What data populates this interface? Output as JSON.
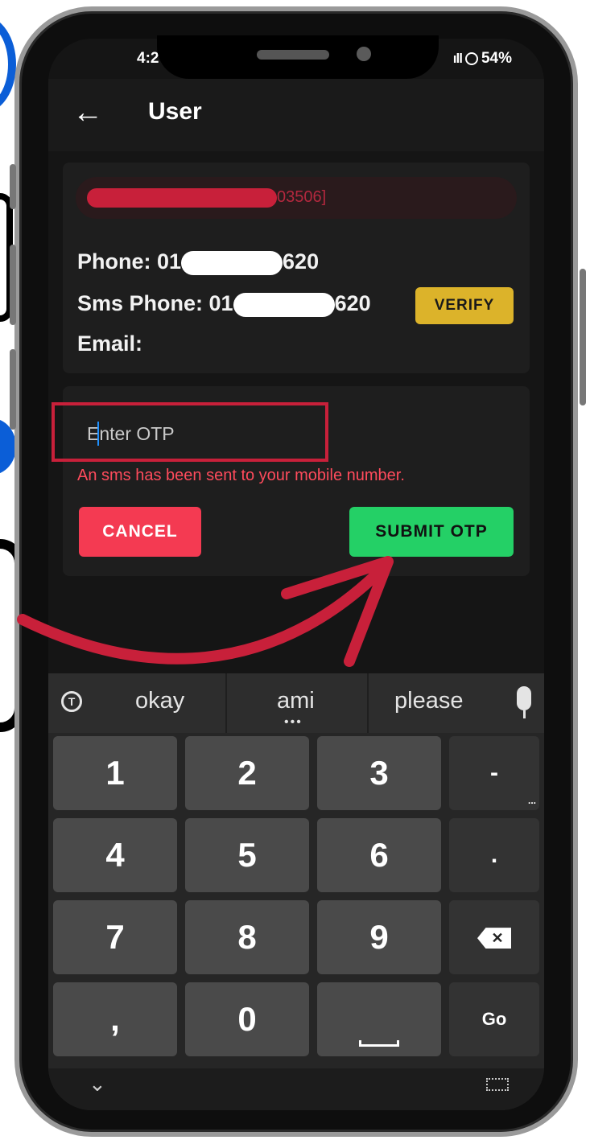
{
  "status_bar": {
    "time": "4:2",
    "signal": "ıll",
    "battery": "54%"
  },
  "app_bar": {
    "back_icon": "arrow-left-icon",
    "title": "User"
  },
  "user_card": {
    "id_suffix": "03506]",
    "phone_label": "Phone: 01",
    "phone_suffix": "620",
    "sms_phone_label": "Sms Phone: 01",
    "sms_phone_suffix": "620",
    "verify_label": "VERIFY",
    "email_label": "Email:"
  },
  "otp_dialog": {
    "input_placeholder": "Enter OTP",
    "input_value": "",
    "sms_note": "An sms has been sent to your mobile number.",
    "cancel_label": "CANCEL",
    "submit_label": "SUBMIT OTP"
  },
  "keyboard": {
    "suggestions": [
      "okay",
      "ami",
      "please"
    ],
    "dots": "•••",
    "keys": {
      "k1": "1",
      "k2": "2",
      "k3": "3",
      "minus": "-",
      "k4": "4",
      "k5": "5",
      "k6": "6",
      "dot": ".",
      "k7": "7",
      "k8": "8",
      "k9": "9",
      "backspace": "✕",
      "comma": ",",
      "k0": "0",
      "go": "Go"
    },
    "more": "..."
  },
  "colors": {
    "accent_red": "#c8203a",
    "verify_yellow": "#dcb32a",
    "cancel_red": "#f43a52",
    "submit_green": "#24d066"
  }
}
